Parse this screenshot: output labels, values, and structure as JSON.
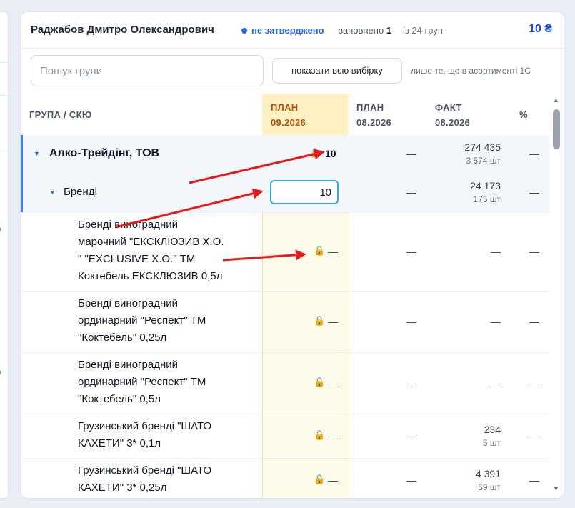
{
  "side_panel": {
    "pct1": "%",
    "pct2": "%"
  },
  "header": {
    "name": "Раджабов Дмитро Олександрович",
    "status": "не затверджено",
    "filled_prefix": "заповнено",
    "filled_count": "1",
    "of_groups": "із 24 груп",
    "total": "10 ₴"
  },
  "toolbar": {
    "search_placeholder": "Пошук групи",
    "show_all_label": "показати всю вибірку",
    "assortment_note": "лише те, що в асортименті 1С"
  },
  "columns": {
    "group": "ГРУПА / СКЮ",
    "plan_current_1": "ПЛАН",
    "plan_current_2": "09.2026",
    "plan_prev_1": "ПЛАН",
    "plan_prev_2": "08.2026",
    "fact_1": "ФАКТ",
    "fact_2": "08.2026",
    "pct": "%"
  },
  "rows": [
    {
      "label": "Алко-Трейдінг, ТОВ",
      "plan": "10",
      "plan_prev": "—",
      "fact": "274 435",
      "fact_qty": "3 574 шт",
      "pct": "—"
    },
    {
      "label": "Бренді",
      "plan_input": "10",
      "plan_prev": "—",
      "fact": "24 173",
      "fact_qty": "175 шт",
      "pct": "—"
    },
    {
      "label_lines": [
        "Бренді виноградний",
        "марочний \"ЕКСКЛЮЗИВ Х.О.",
        "\" \"EXCLUSIVE X.O.\" ТМ",
        "Коктебель ЕКСКЛЮЗИВ 0,5л"
      ],
      "plan": "—",
      "plan_prev": "—",
      "fact": "—",
      "pct": "—"
    },
    {
      "label_lines": [
        "Бренді виноградний",
        "ординарний \"Респект\" ТМ",
        "\"Коктебель\" 0,25л"
      ],
      "plan": "—",
      "plan_prev": "—",
      "fact": "—",
      "pct": "—"
    },
    {
      "label_lines": [
        "Бренді виноградний",
        "ординарний \"Респект\" ТМ",
        "\"Коктебель\" 0,5л"
      ],
      "plan": "—",
      "plan_prev": "—",
      "fact": "—",
      "pct": "—"
    },
    {
      "label_lines": [
        "Грузинський бренді \"ШАТО",
        "КАХЕТИ\" 3* 0,1л"
      ],
      "plan": "—",
      "plan_prev": "—",
      "fact": "234",
      "fact_qty": "5 шт",
      "pct": "—"
    },
    {
      "label_lines": [
        "Грузинський бренді \"ШАТО",
        "КАХЕТИ\" 3* 0,25л"
      ],
      "plan": "—",
      "plan_prev": "—",
      "fact": "4 391",
      "fact_qty": "59 шт",
      "pct": "—"
    }
  ],
  "icons": {
    "lock": "lock-icon",
    "caret": "caret-down-icon"
  },
  "colors": {
    "accent": "#2563eb",
    "plan_highlight": "#fffbea",
    "annotation": "#e11d1d"
  }
}
